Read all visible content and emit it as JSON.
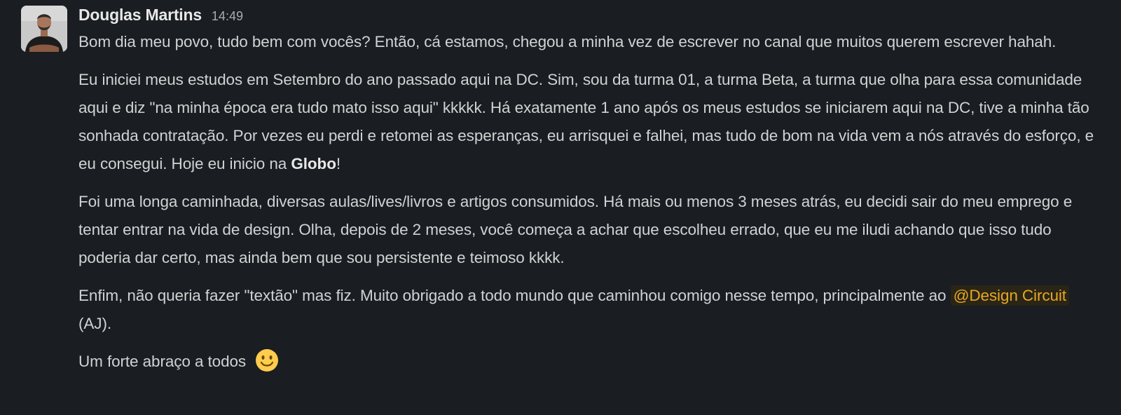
{
  "message": {
    "author": "Douglas Martins",
    "time": "14:49",
    "p1": "Bom dia meu povo, tudo bem com vocês? Então, cá estamos, chegou a minha vez de escrever no canal que muitos querem escrever hahah.",
    "p2_before": "Eu iniciei meus estudos em Setembro do ano passado aqui na DC. Sim, sou da turma 01, a turma Beta, a turma que olha para essa comunidade aqui e diz \"na minha época era tudo mato isso aqui\" kkkkk. Há exatamente 1 ano após os meus estudos se iniciarem aqui na DC, tive a minha tão sonhada contratação. Por vezes eu perdi e retomei as esperanças, eu arrisquei e falhei, mas tudo de bom na vida vem a nós através do esforço, e eu consegui. Hoje eu inicio na ",
    "p2_bold": "Globo",
    "p2_after": "!",
    "p3": "Foi uma longa caminhada, diversas aulas/lives/livros e artigos consumidos. Há mais ou menos 3 meses atrás, eu decidi sair do meu emprego e tentar entrar na vida de design. Olha, depois de 2 meses, você começa a achar que escolheu errado, que eu me iludi achando que isso tudo poderia dar certo, mas ainda bem que sou persistente e teimoso kkkk.",
    "p4_before": "Enfim, não queria fazer \"textão\" mas fiz. Muito obrigado a todo mundo que caminhou comigo nesse tempo, principalmente ao ",
    "p4_mention": "@Design Circuit",
    "p4_after": " (AJ).",
    "p5": "Um forte abraço a todos"
  },
  "icons": {
    "emoji": "slightly-smiling-face-icon",
    "avatar": "user-avatar"
  },
  "colors": {
    "background": "#1a1d21",
    "text": "#d1d2d3",
    "mention_text": "#e8a823",
    "mention_bg": "#2a2516"
  }
}
